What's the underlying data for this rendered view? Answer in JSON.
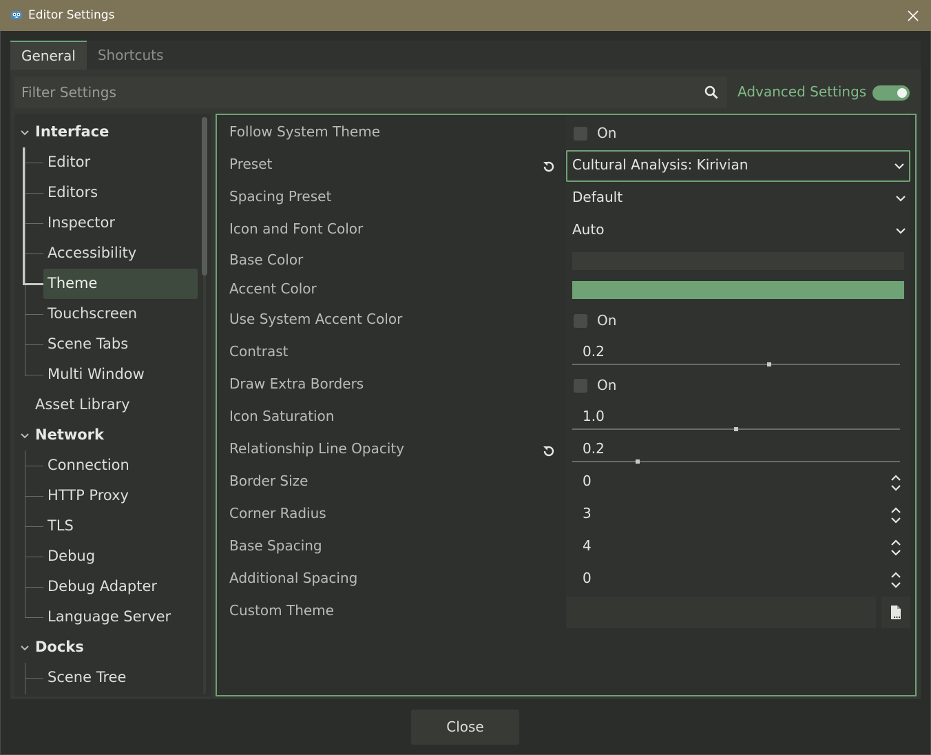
{
  "window": {
    "title": "Editor Settings",
    "icon": "godot-icon",
    "close_icon": "close-icon"
  },
  "tabs": [
    {
      "label": "General",
      "active": true
    },
    {
      "label": "Shortcuts",
      "active": false
    }
  ],
  "filter": {
    "placeholder": "Filter Settings",
    "value": ""
  },
  "advanced": {
    "label": "Advanced Settings",
    "enabled": true
  },
  "sidebar": {
    "sections": [
      {
        "label": "Interface",
        "expanded": true,
        "items": [
          "Editor",
          "Editors",
          "Inspector",
          "Accessibility",
          "Theme",
          "Touchscreen",
          "Scene Tabs",
          "Multi Window"
        ]
      },
      {
        "label": "Asset Library"
      },
      {
        "label": "Network",
        "expanded": true,
        "items": [
          "Connection",
          "HTTP Proxy",
          "TLS",
          "Debug",
          "Debug Adapter",
          "Language Server"
        ]
      },
      {
        "label": "Docks",
        "expanded": true,
        "items": [
          "Scene Tree"
        ]
      }
    ],
    "selected": "Theme"
  },
  "settings": {
    "follow_system_theme": {
      "label": "Follow System Theme",
      "value": "On",
      "checked": false
    },
    "preset": {
      "label": "Preset",
      "value": "Cultural Analysis: Kirivian"
    },
    "spacing_preset": {
      "label": "Spacing Preset",
      "value": "Default"
    },
    "icon_font_color": {
      "label": "Icon and Font Color",
      "value": "Auto"
    },
    "base_color": {
      "label": "Base Color",
      "color": "#3a3c38"
    },
    "accent_color": {
      "label": "Accent Color",
      "color": "#6fa376"
    },
    "use_system_accent": {
      "label": "Use System Accent Color",
      "value": "On",
      "checked": false
    },
    "contrast": {
      "label": "Contrast",
      "value": "0.2",
      "fraction": 0.6
    },
    "draw_extra_borders": {
      "label": "Draw Extra Borders",
      "value": "On",
      "checked": false
    },
    "icon_saturation": {
      "label": "Icon Saturation",
      "value": "1.0",
      "fraction": 0.5
    },
    "relationship_line_opacity": {
      "label": "Relationship Line Opacity",
      "value": "0.2",
      "fraction": 0.2
    },
    "border_size": {
      "label": "Border Size",
      "value": "0"
    },
    "corner_radius": {
      "label": "Corner Radius",
      "value": "3"
    },
    "base_spacing": {
      "label": "Base Spacing",
      "value": "4"
    },
    "additional_spacing": {
      "label": "Additional Spacing",
      "value": "0"
    },
    "custom_theme": {
      "label": "Custom Theme",
      "value": ""
    }
  },
  "footer": {
    "close_label": "Close"
  }
}
